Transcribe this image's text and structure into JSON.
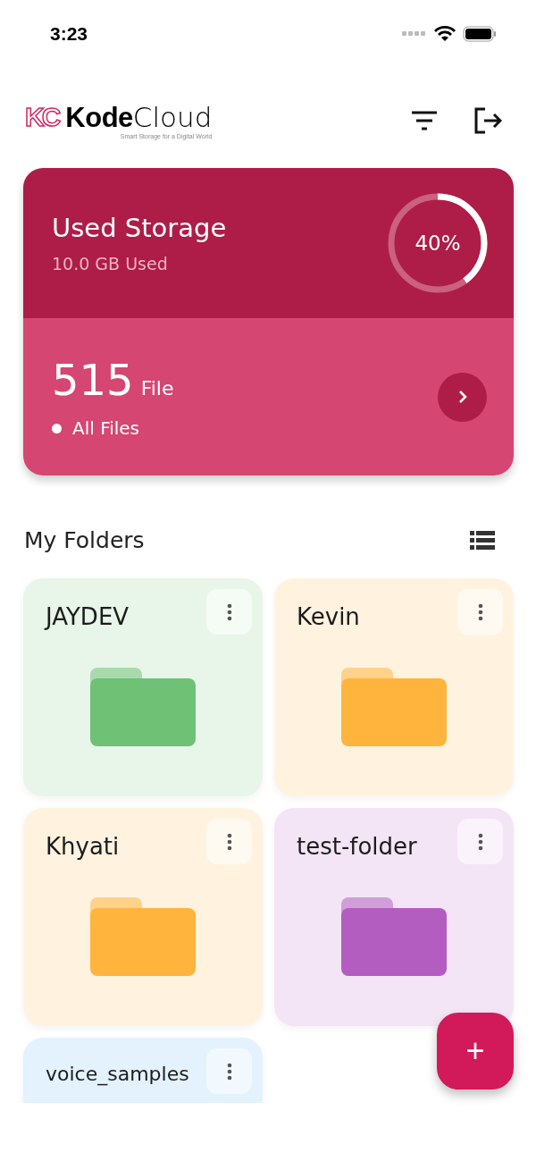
{
  "status_bar": {
    "time": "3:23"
  },
  "header": {
    "logo": {
      "mark": "KC",
      "bold": "Kode",
      "light": "Cloud",
      "tagline": "Smart Storage for a Digital World"
    }
  },
  "storage": {
    "title": "Used Storage",
    "used": "10.0 GB Used",
    "level": 0.4,
    "percent": "40%",
    "count": "515",
    "count_unit": "File",
    "link": "All Files"
  },
  "folders_section": {
    "title": "My Folders"
  },
  "folders": [
    {
      "name": "JAYDEV",
      "color": "#e8f5e9"
    },
    {
      "name": "Kevin",
      "color": "#fff3e0"
    },
    {
      "name": "Khyati",
      "color": "#fff3e0"
    },
    {
      "name": "test-folder",
      "color": "#f3e5f5"
    },
    {
      "name": "voice_samples",
      "color": "#e3f2fd"
    }
  ],
  "fab": {
    "label": "+"
  }
}
